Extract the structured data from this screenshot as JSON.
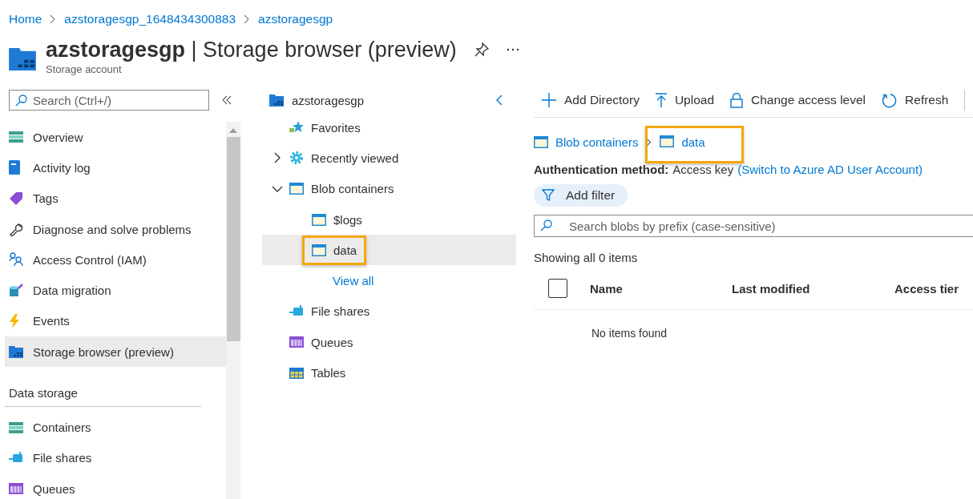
{
  "breadcrumb": [
    {
      "label": "Home"
    },
    {
      "label": "azstoragesgp_1648434300883"
    },
    {
      "label": "azstoragesgp"
    }
  ],
  "header": {
    "resource": "azstoragesgp",
    "separator": "|",
    "page": "Storage browser (preview)",
    "subtitle": "Storage account"
  },
  "sidebar": {
    "search": {
      "placeholder": "Search (Ctrl+/)"
    },
    "items": [
      {
        "label": "Overview",
        "kind": "overview",
        "selected": false
      },
      {
        "label": "Activity log",
        "kind": "log",
        "selected": false
      },
      {
        "label": "Tags",
        "kind": "tag",
        "selected": false
      },
      {
        "label": "Diagnose and solve problems",
        "kind": "wrench",
        "selected": false
      },
      {
        "label": "Access Control (IAM)",
        "kind": "people",
        "selected": false
      },
      {
        "label": "Data migration",
        "kind": "migration",
        "selected": false
      },
      {
        "label": "Events",
        "kind": "bolt",
        "selected": false
      },
      {
        "label": "Storage browser (preview)",
        "kind": "storage",
        "selected": true
      }
    ],
    "data_storage": {
      "title": "Data storage",
      "items": [
        {
          "label": "Containers",
          "kind": "overview",
          "selected": false
        },
        {
          "label": "File shares",
          "kind": "fileshare",
          "selected": false
        },
        {
          "label": "Queues",
          "kind": "queue",
          "selected": false
        }
      ]
    }
  },
  "tree": {
    "root": {
      "label": "azstoragesgp"
    },
    "items": [
      {
        "label": "Favorites",
        "kind": "star",
        "selected": false,
        "highlighted": false
      },
      {
        "label": "Recently viewed",
        "kind": "gear",
        "expanded": false,
        "selected": false,
        "highlighted": false
      },
      {
        "label": "Blob containers",
        "kind": "container",
        "expanded": true,
        "selected": false,
        "highlighted": false,
        "children": [
          {
            "label": "$logs",
            "kind": "container",
            "selected": false,
            "highlighted": false
          },
          {
            "label": "data",
            "kind": "container",
            "selected": true,
            "highlighted": true
          },
          {
            "label": "View all",
            "kind": "link",
            "selected": false,
            "highlighted": false
          }
        ]
      },
      {
        "label": "File shares",
        "kind": "fileshare",
        "selected": false,
        "highlighted": false
      },
      {
        "label": "Queues",
        "kind": "queue",
        "selected": false,
        "highlighted": false
      },
      {
        "label": "Tables",
        "kind": "table",
        "selected": false,
        "highlighted": false
      }
    ]
  },
  "toolbar": [
    {
      "label": "Add Directory",
      "kind": "plus"
    },
    {
      "label": "Upload",
      "kind": "upload"
    },
    {
      "label": "Change access level",
      "kind": "lock"
    },
    {
      "label": "Refresh",
      "kind": "refresh"
    }
  ],
  "path": [
    {
      "label": "Blob containers",
      "highlighted": false
    },
    {
      "label": "data",
      "highlighted": true
    }
  ],
  "auth": {
    "label": "Authentication method:",
    "value": "Access key",
    "link": "(Switch to Azure AD User Account)"
  },
  "filter_button": {
    "label": "Add filter"
  },
  "blob_search": {
    "placeholder": "Search blobs by prefix (case-sensitive)"
  },
  "count": "Showing all 0 items",
  "table": {
    "select_all": {
      "checked": false
    },
    "columns": [
      "Name",
      "Last modified",
      "Access tier"
    ],
    "empty": "No items found"
  }
}
